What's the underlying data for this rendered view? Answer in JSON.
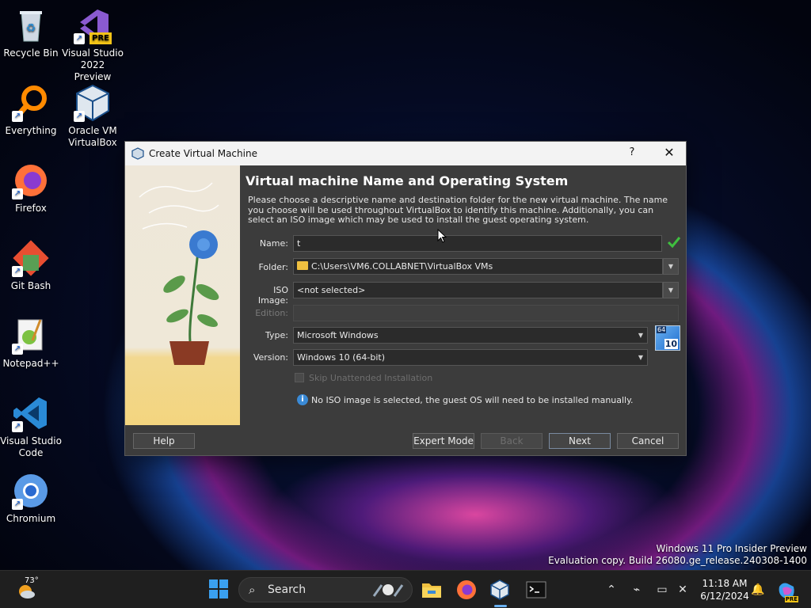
{
  "desktop": {
    "icons": [
      {
        "label": "Recycle Bin"
      },
      {
        "label": "Visual Studio 2022 Preview",
        "badge": "PRE"
      },
      {
        "label": "Everything"
      },
      {
        "label": "Oracle VM VirtualBox"
      },
      {
        "label": "Firefox"
      },
      {
        "label": "Git Bash"
      },
      {
        "label": "Notepad++"
      },
      {
        "label": "Visual Studio Code"
      },
      {
        "label": "Chromium"
      }
    ]
  },
  "dialog": {
    "title": "Create Virtual Machine",
    "help_glyph": "?",
    "close_glyph": "✕",
    "heading": "Virtual machine Name and Operating System",
    "description": "Please choose a descriptive name and destination folder for the new virtual machine. The name you choose will be used throughout VirtualBox to identify this machine. Additionally, you can select an ISO image which may be used to install the guest operating system.",
    "form": {
      "name_label": "Name:",
      "name_value": "t",
      "folder_label": "Folder:",
      "folder_value": "C:\\Users\\VM6.COLLABNET\\VirtualBox VMs",
      "iso_label": "ISO Image:",
      "iso_value": "<not selected>",
      "edition_label": "Edition:",
      "edition_value": "",
      "type_label": "Type:",
      "type_value": "Microsoft Windows",
      "version_label": "Version:",
      "version_value": "Windows 10 (64-bit)",
      "os_badge_top": "64",
      "os_badge_bottom": "10",
      "skip_label": "Skip Unattended Installation",
      "info_text": "No ISO image is selected, the guest OS will need to be installed manually."
    },
    "buttons": {
      "help": "Help",
      "expert": "Expert Mode",
      "back": "Back",
      "next": "Next",
      "cancel": "Cancel"
    }
  },
  "watermark": {
    "line1": "Windows 11 Pro Insider Preview",
    "line2": "Evaluation copy. Build 26080.ge_release.240308-1400"
  },
  "taskbar": {
    "weather_temp": "73°",
    "search_placeholder": "Search",
    "time": "11:18 AM",
    "date": "6/12/2024",
    "copilot_badge": "PRE"
  },
  "colors": {
    "accent": "#1f6fd0",
    "ok_green": "#3fbf3f",
    "folder_yellow": "#f0c040"
  }
}
